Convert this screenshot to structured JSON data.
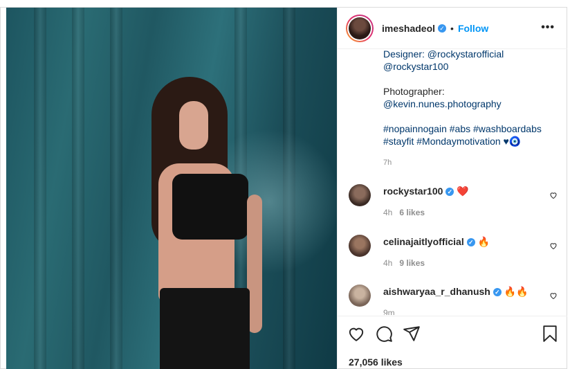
{
  "post": {
    "username": "imeshadeol",
    "follow_label": "Follow",
    "separator": "•",
    "more_label": "•••",
    "caption_lines": [
      "Designer: @rockystarofficial",
      "@rockystar100",
      "",
      "Photographer:",
      "@kevin.nunes.photography",
      "",
      "#nopainnogain #abs #washboardabs",
      "#stayfit #Mondaymotivation ♥🧿"
    ],
    "caption_time": "7h",
    "likes": "27,056 likes"
  },
  "comments": [
    {
      "user": "rockystar100",
      "text": "❤️",
      "time": "4h",
      "likes": "6 likes",
      "verified": true
    },
    {
      "user": "celinajaitlyofficial",
      "text": "🔥",
      "time": "4h",
      "likes": "9 likes",
      "verified": true
    },
    {
      "user": "aishwaryaa_r_dhanush",
      "text": "🔥🔥",
      "time": "9m",
      "likes": "",
      "verified": true
    }
  ],
  "colors": {
    "accent": "#0095f6",
    "link": "#00376b",
    "muted": "#8e8e8e",
    "verified": "#3897f0"
  },
  "icons": [
    "heart-icon",
    "comment-icon",
    "share-icon",
    "bookmark-icon",
    "verified-badge-icon",
    "more-options-icon"
  ]
}
